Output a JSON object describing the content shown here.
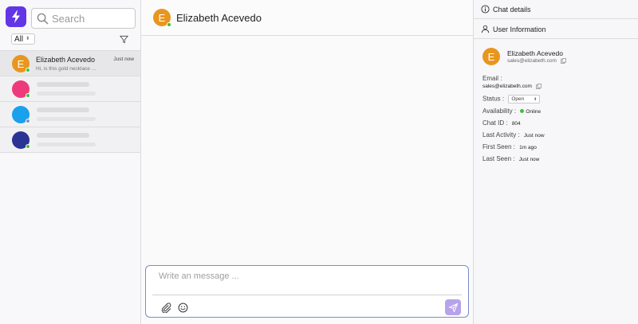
{
  "search": {
    "placeholder": "Search"
  },
  "filter": {
    "selected": "All"
  },
  "conversations": [
    {
      "initial": "E",
      "name": "Elizabeth Acevedo",
      "time": "Just now",
      "preview": "Hi, is this gold necklace ...",
      "avatar_color": "#e8961e",
      "status_color": "#3cc13b"
    },
    {
      "avatar_color": "#ee3a7a",
      "status_color": "#3cc13b"
    },
    {
      "avatar_color": "#1aa0ec",
      "status_color": "#8a8fb0"
    },
    {
      "avatar_color": "#2b3494",
      "status_color": "#3cc13b"
    }
  ],
  "chat": {
    "contact_initial": "E",
    "contact_name": "Elizabeth Acevedo",
    "composer_placeholder": "Write an message ..."
  },
  "details": {
    "header": "Chat details",
    "section": "User Information",
    "initial": "E",
    "name": "Elizabeth Acevedo",
    "email": "sales@elizabeth.com",
    "email_label": "Email :",
    "email_value": "sales@elizabeth.com",
    "status_label": "Status :",
    "status_value": "Open",
    "availability_label": "Availability :",
    "availability_value": "Online",
    "chat_id_label": "Chat ID :",
    "chat_id_value": "804",
    "last_activity_label": "Last Activity :",
    "last_activity_value": "Just now",
    "first_seen_label": "First Seen :",
    "first_seen_value": "1m ago",
    "last_seen_label": "Last Seen :",
    "last_seen_value": "Just now"
  },
  "colors": {
    "brand": "#6236e6",
    "online": "#3cc13b",
    "send_button": "#b7a3ea",
    "composer_border": "#7a8ccc"
  }
}
